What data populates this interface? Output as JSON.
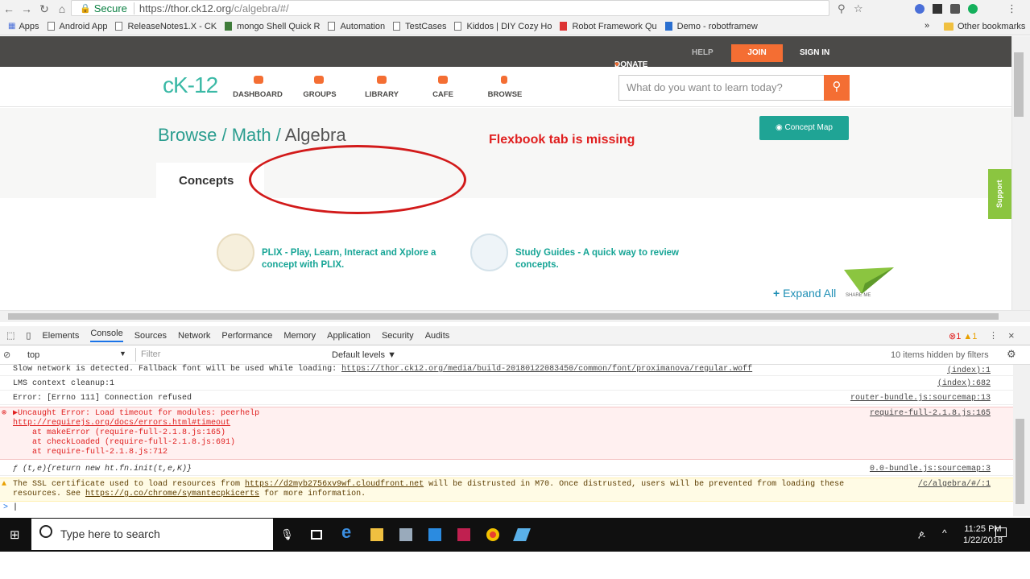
{
  "browser": {
    "secure_label": "Secure",
    "url_host": "https://thor.ck12.org",
    "url_path": "/c/algebra/#/",
    "bookmarks": [
      "Apps",
      "Android App",
      "ReleaseNotes1.X - CK",
      "mongo Shell Quick R",
      "Automation",
      "TestCases",
      "Kiddos | DIY Cozy Ho",
      "Robot Framework Qu",
      "Demo - robotframew"
    ],
    "overflow": "»",
    "other_bookmarks": "Other bookmarks"
  },
  "site": {
    "top_links": {
      "donate": "DONATE",
      "help": "HELP",
      "join": "JOIN",
      "signin": "SIGN IN"
    },
    "logo": "cK-12",
    "nav": [
      "DASHBOARD",
      "GROUPS",
      "LIBRARY",
      "CAFE",
      "BROWSE"
    ],
    "search_placeholder": "What do you want to learn today?",
    "breadcrumb": {
      "browse": "Browse",
      "sep1": " / ",
      "math": "Math",
      "sep2": " / ",
      "current": "Algebra"
    },
    "concept_map": "Concept Map",
    "annotation": "Flexbook tab is missing",
    "tab_concepts": "Concepts",
    "support": "Support",
    "feature1": "PLIX - Play, Learn, Interact and Xplore a concept with PLIX.",
    "feature2": "Study Guides - A quick way to review concepts.",
    "expand_all": "Expand All",
    "share_me": "SHARE ME"
  },
  "devtools": {
    "tabs": [
      "Elements",
      "Console",
      "Sources",
      "Network",
      "Performance",
      "Memory",
      "Application",
      "Security",
      "Audits"
    ],
    "active_tab": "Console",
    "error_count": "1",
    "warn_count": "1",
    "context": "top",
    "filter_placeholder": "Filter",
    "levels": "Default levels ▼",
    "hidden": "10 items hidden by filters",
    "rows": [
      {
        "text": "Slow network is detected. Fallback font will be used while loading: ",
        "link": "https://thor.ck12.org/media/build-20180122083450/common/font/proximanova/regular.woff",
        "src": "(index):1"
      },
      {
        "text": "LMS context cleanup:1",
        "link": "",
        "src": "(index):682"
      },
      {
        "text": "Error: [Errno 111] Connection refused",
        "link": "",
        "src": "router-bundle.js:sourcemap:13"
      }
    ],
    "error": {
      "line1": "▶Uncaught Error: Load timeout for modules: peerhelp",
      "line2": "http://requirejs.org/docs/errors.html#timeout",
      "line3": "    at makeError (require-full-2.1.8.js:165)",
      "line4": "    at checkLoaded (require-full-2.1.8.js:691)",
      "line5": "    at require-full-2.1.8.js:712",
      "src": "require-full-2.1.8.js:165"
    },
    "func_row": {
      "text": "ƒ (t,e){return new ht.fn.init(t,e,K)}",
      "src": "0.0-bundle.js:sourcemap:3"
    },
    "warning": {
      "line1a": "The SSL certificate used to load resources from ",
      "link1": "https://d2myb2756xv9wf.cloudfront.net",
      "line1b": " will be distrusted in M70. Once distrusted, users will be prevented from loading these",
      "line2a": "resources. See ",
      "link2": "https://g.co/chrome/symantecpkicerts",
      "line2b": " for more information.",
      "src": "/c/algebra/#/:1"
    },
    "prompt": ">"
  },
  "taskbar": {
    "search_placeholder": "Type here to search",
    "time": "11:25 PM",
    "date": "1/22/2018"
  }
}
